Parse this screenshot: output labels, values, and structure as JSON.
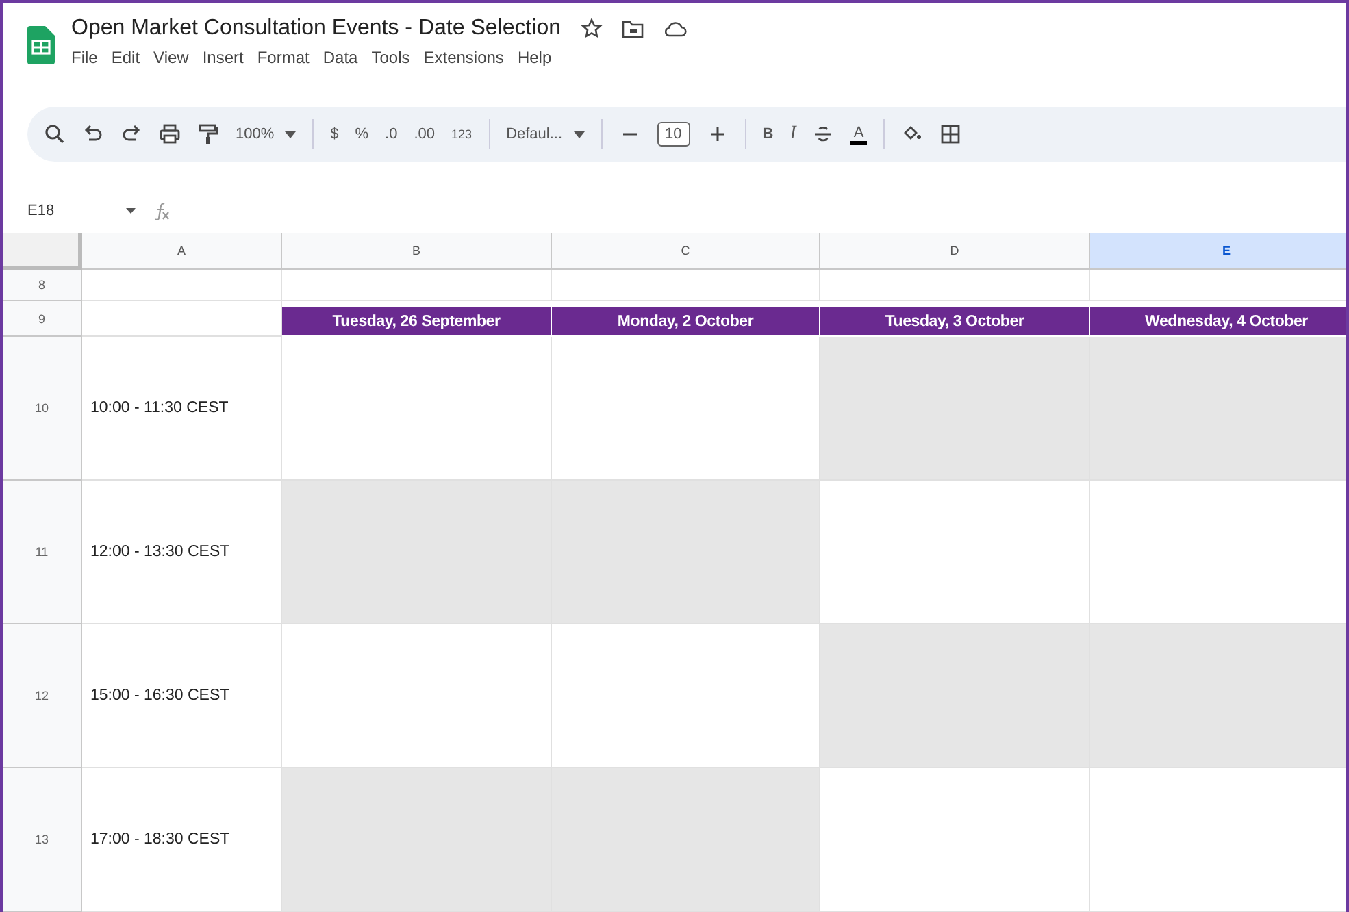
{
  "document": {
    "title": "Open Market Consultation Events - Date Selection"
  },
  "menu": [
    "File",
    "Edit",
    "View",
    "Insert",
    "Format",
    "Data",
    "Tools",
    "Extensions",
    "Help"
  ],
  "toolbar": [
    {
      "kind": "search"
    },
    {
      "kind": "undo"
    },
    {
      "kind": "redo"
    },
    {
      "kind": "print"
    },
    {
      "kind": "paint"
    },
    {
      "kind": "dropdown",
      "text": "100%"
    },
    {
      "kind": "sep"
    },
    {
      "kind": "text",
      "text": "$"
    },
    {
      "kind": "text",
      "text": "%"
    },
    {
      "kind": "text",
      "text": ".0"
    },
    {
      "kind": "text",
      "text": ".00"
    },
    {
      "kind": "small",
      "text": "123"
    },
    {
      "kind": "sep"
    },
    {
      "kind": "dropdown",
      "text": "Defaul..."
    },
    {
      "kind": "sep"
    },
    {
      "kind": "minus"
    },
    {
      "kind": "field",
      "text": "10"
    },
    {
      "kind": "plus"
    },
    {
      "kind": "sep"
    },
    {
      "kind": "bold",
      "text": "B"
    },
    {
      "kind": "italic",
      "text": "I"
    },
    {
      "kind": "strike"
    },
    {
      "kind": "color",
      "text": "A"
    },
    {
      "kind": "sep"
    },
    {
      "kind": "fill"
    },
    {
      "kind": "borders"
    }
  ],
  "formula_bar": {
    "cell": "E18"
  },
  "columns": [
    {
      "label": "A",
      "selected": false
    },
    {
      "label": "B",
      "selected": false
    },
    {
      "label": "C",
      "selected": false
    },
    {
      "label": "D",
      "selected": false
    },
    {
      "label": "E",
      "selected": true
    }
  ],
  "rows": [
    {
      "kind": "blank",
      "number": "8"
    },
    {
      "kind": "dates",
      "number": "9",
      "dates": [
        "Tuesday, 26 September",
        "Monday, 2 October",
        "Tuesday, 3 October",
        "Wednesday, 4 October"
      ]
    },
    {
      "kind": "slot",
      "number": "10",
      "time": "10:00 - 11:30 CEST",
      "cells": [
        {
          "shaded": false
        },
        {
          "shaded": false
        },
        {
          "shaded": true
        },
        {
          "shaded": true
        }
      ]
    },
    {
      "kind": "slot",
      "number": "11",
      "time": "12:00 - 13:30 CEST",
      "cells": [
        {
          "shaded": true
        },
        {
          "shaded": true
        },
        {
          "shaded": false
        },
        {
          "shaded": false
        }
      ]
    },
    {
      "kind": "slot",
      "number": "12",
      "time": "15:00 - 16:30 CEST",
      "cells": [
        {
          "shaded": false
        },
        {
          "shaded": false
        },
        {
          "shaded": true
        },
        {
          "shaded": true
        }
      ]
    },
    {
      "kind": "slot",
      "number": "13",
      "time": "17:00 - 18:30 CEST",
      "cells": [
        {
          "shaded": true
        },
        {
          "shaded": true
        },
        {
          "shaded": false
        },
        {
          "shaded": false
        }
      ]
    }
  ]
}
